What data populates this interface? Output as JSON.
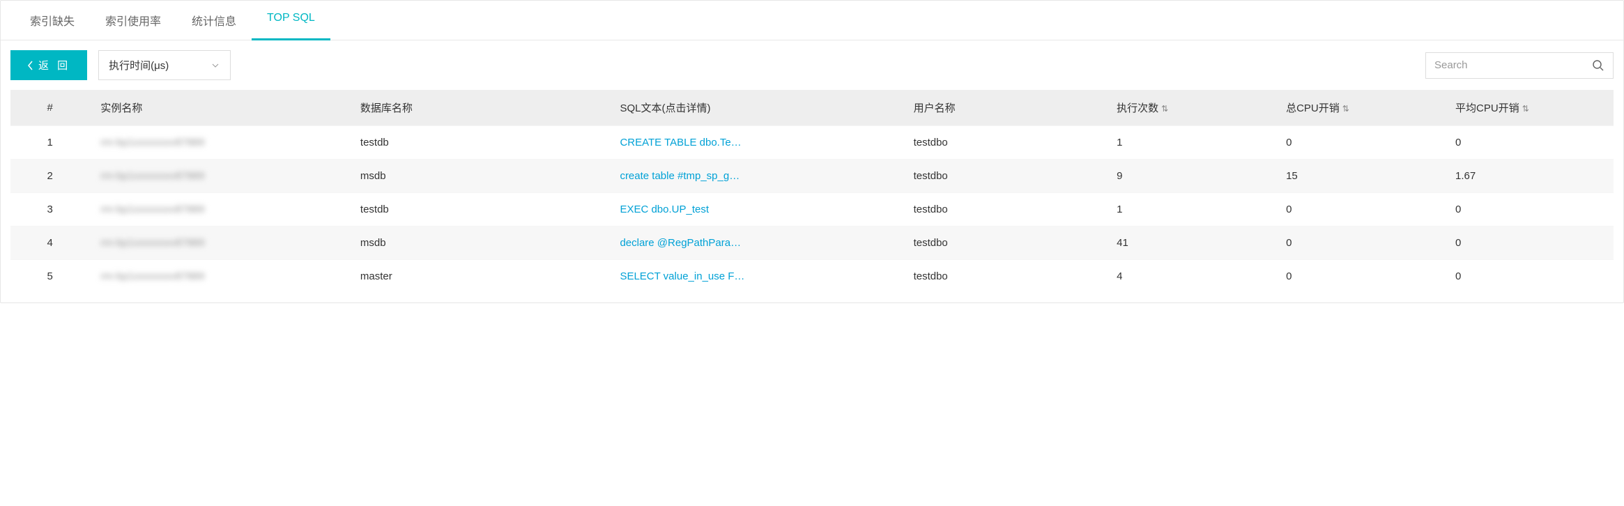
{
  "tabs": [
    {
      "label": "索引缺失",
      "active": false
    },
    {
      "label": "索引使用率",
      "active": false
    },
    {
      "label": "统计信息",
      "active": false
    },
    {
      "label": "TOP SQL",
      "active": true
    }
  ],
  "back_button": "返 回",
  "metric_select": {
    "value": "执行时间(μs)"
  },
  "search": {
    "placeholder": "Search"
  },
  "table": {
    "headers": {
      "index": "#",
      "instance": "实例名称",
      "database": "数据库名称",
      "sql": "SQL文本(点击详情)",
      "user": "用户名称",
      "exec_count": "执行次数",
      "cpu_total": "总CPU开销",
      "cpu_avg": "平均CPU开销"
    },
    "rows": [
      {
        "idx": "1",
        "instance": "rm-bp1xxxxxxxv87889",
        "db": "testdb",
        "sql": "CREATE TABLE dbo.Te…",
        "user": "testdbo",
        "exec": "1",
        "cpu_total": "0",
        "cpu_avg": "0"
      },
      {
        "idx": "2",
        "instance": "rm-bp1xxxxxxxv87889",
        "db": "msdb",
        "sql": "create table #tmp_sp_g…",
        "user": "testdbo",
        "exec": "9",
        "cpu_total": "15",
        "cpu_avg": "1.67"
      },
      {
        "idx": "3",
        "instance": "rm-bp1xxxxxxxv87889",
        "db": "testdb",
        "sql": "EXEC dbo.UP_test",
        "user": "testdbo",
        "exec": "1",
        "cpu_total": "0",
        "cpu_avg": "0"
      },
      {
        "idx": "4",
        "instance": "rm-bp1xxxxxxxv87889",
        "db": "msdb",
        "sql": "declare @RegPathPara…",
        "user": "testdbo",
        "exec": "41",
        "cpu_total": "0",
        "cpu_avg": "0"
      },
      {
        "idx": "5",
        "instance": "rm-bp1xxxxxxxv87889",
        "db": "master",
        "sql": "SELECT value_in_use F…",
        "user": "testdbo",
        "exec": "4",
        "cpu_total": "0",
        "cpu_avg": "0"
      }
    ]
  }
}
